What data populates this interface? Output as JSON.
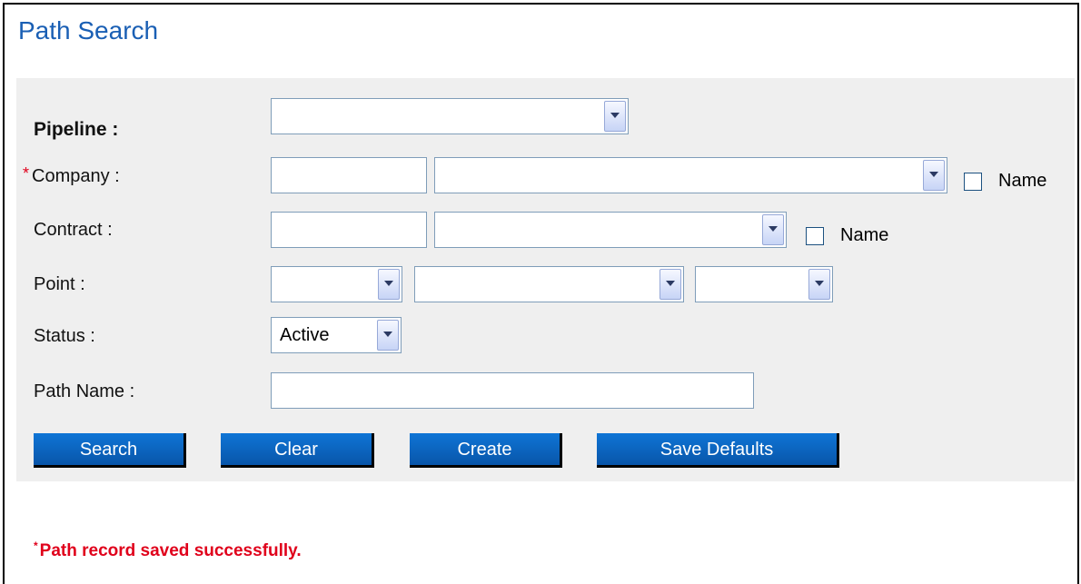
{
  "title": "Path Search",
  "form": {
    "pipeline": {
      "label": "Pipeline :",
      "value": ""
    },
    "company": {
      "required_mark": "*",
      "label": "Company :",
      "code_value": "",
      "select_value": "",
      "name_label": "Name"
    },
    "contract": {
      "label": "Contract :",
      "code_value": "",
      "select_value": "",
      "name_label": "Name"
    },
    "point": {
      "label": "Point :",
      "select1": "",
      "select2": "",
      "select3": ""
    },
    "status": {
      "label": "Status :",
      "value": "Active"
    },
    "path_name": {
      "label": "Path Name :",
      "value": ""
    }
  },
  "buttons": {
    "search": "Search",
    "clear": "Clear",
    "create": "Create",
    "save_defaults": "Save Defaults"
  },
  "message": {
    "mark": "*",
    "text": "Path record saved successfully."
  },
  "colors": {
    "title": "#1a5fb4",
    "panel": "#efefef",
    "button": "#0a63bf",
    "error": "#e0001b"
  }
}
